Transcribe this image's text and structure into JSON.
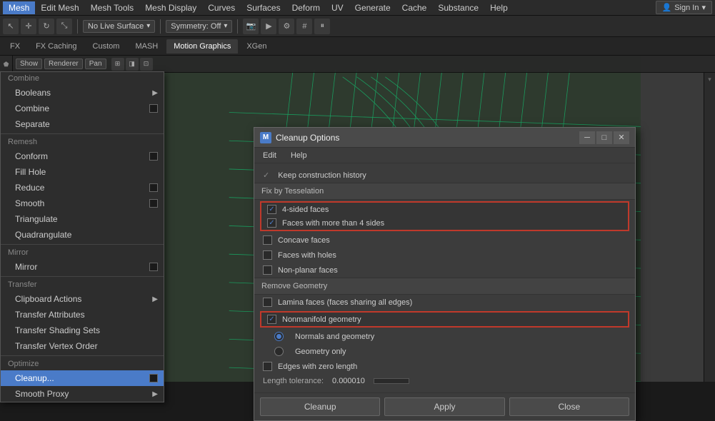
{
  "menubar": {
    "items": [
      "Mesh",
      "Edit Mesh",
      "Mesh Tools",
      "Mesh Display",
      "Curves",
      "Surfaces",
      "Deform",
      "UV",
      "Generate",
      "Cache",
      "Substance",
      "Help"
    ]
  },
  "toolbar": {
    "surface_label": "No Live Surface",
    "symmetry_label": "Symmetry: Off",
    "signin_label": "Sign In"
  },
  "tabs": {
    "items": [
      "FX",
      "FX Caching",
      "Custom",
      "MASH",
      "Motion Graphics",
      "XGen"
    ]
  },
  "mesh_menu": {
    "sections": {
      "combine_header": "Combine",
      "remesh_header": "Remesh",
      "mirror_header": "Mirror",
      "transfer_header": "Transfer",
      "optimize_header": "Optimize"
    },
    "items": {
      "booleans": "Booleans",
      "combine": "Combine",
      "separate": "Separate",
      "conform": "Conform",
      "fill_hole": "Fill Hole",
      "reduce": "Reduce",
      "smooth": "Smooth",
      "triangulate": "Triangulate",
      "quadrangulate": "Quadrangulate",
      "mirror": "Mirror",
      "clipboard_actions": "Clipboard Actions",
      "transfer_attributes": "Transfer Attributes",
      "transfer_shading_sets": "Transfer Shading Sets",
      "transfer_vertex_order": "Transfer Vertex Order",
      "cleanup": "Cleanup...",
      "smooth_proxy": "Smooth Proxy"
    }
  },
  "dialog": {
    "title": "Cleanup Options",
    "title_icon": "M",
    "menu_items": [
      "Edit",
      "Help"
    ],
    "construction_history": "Keep construction history",
    "sections": {
      "fix_by_tesselation": "Fix by Tesselation",
      "remove_geometry": "Remove Geometry"
    },
    "fix_options": [
      {
        "label": "4-sided faces",
        "checked": true,
        "highlighted": true
      },
      {
        "label": "Faces with more than 4 sides",
        "checked": true,
        "highlighted": true
      },
      {
        "label": "Concave faces",
        "checked": false
      },
      {
        "label": "Faces with holes",
        "checked": false
      },
      {
        "label": "Non-planar faces",
        "checked": false
      }
    ],
    "remove_options": [
      {
        "label": "Lamina faces (faces sharing all edges)",
        "checked": false,
        "type": "checkbox"
      },
      {
        "label": "Nonmanifold geometry",
        "checked": true,
        "type": "checkbox",
        "highlighted": true
      },
      {
        "label": "Normals and geometry",
        "checked": true,
        "type": "radio"
      },
      {
        "label": "Geometry only",
        "checked": false,
        "type": "radio"
      },
      {
        "label": "Edges with zero length",
        "checked": false,
        "type": "checkbox"
      }
    ],
    "footer": {
      "cleanup_label": "Cleanup",
      "apply_label": "Apply",
      "close_label": "Close"
    },
    "controls": {
      "minimize": "─",
      "maximize": "□",
      "close": "✕"
    }
  },
  "viewport": {
    "renderer": "Renderer",
    "pan_label": "Pan"
  }
}
